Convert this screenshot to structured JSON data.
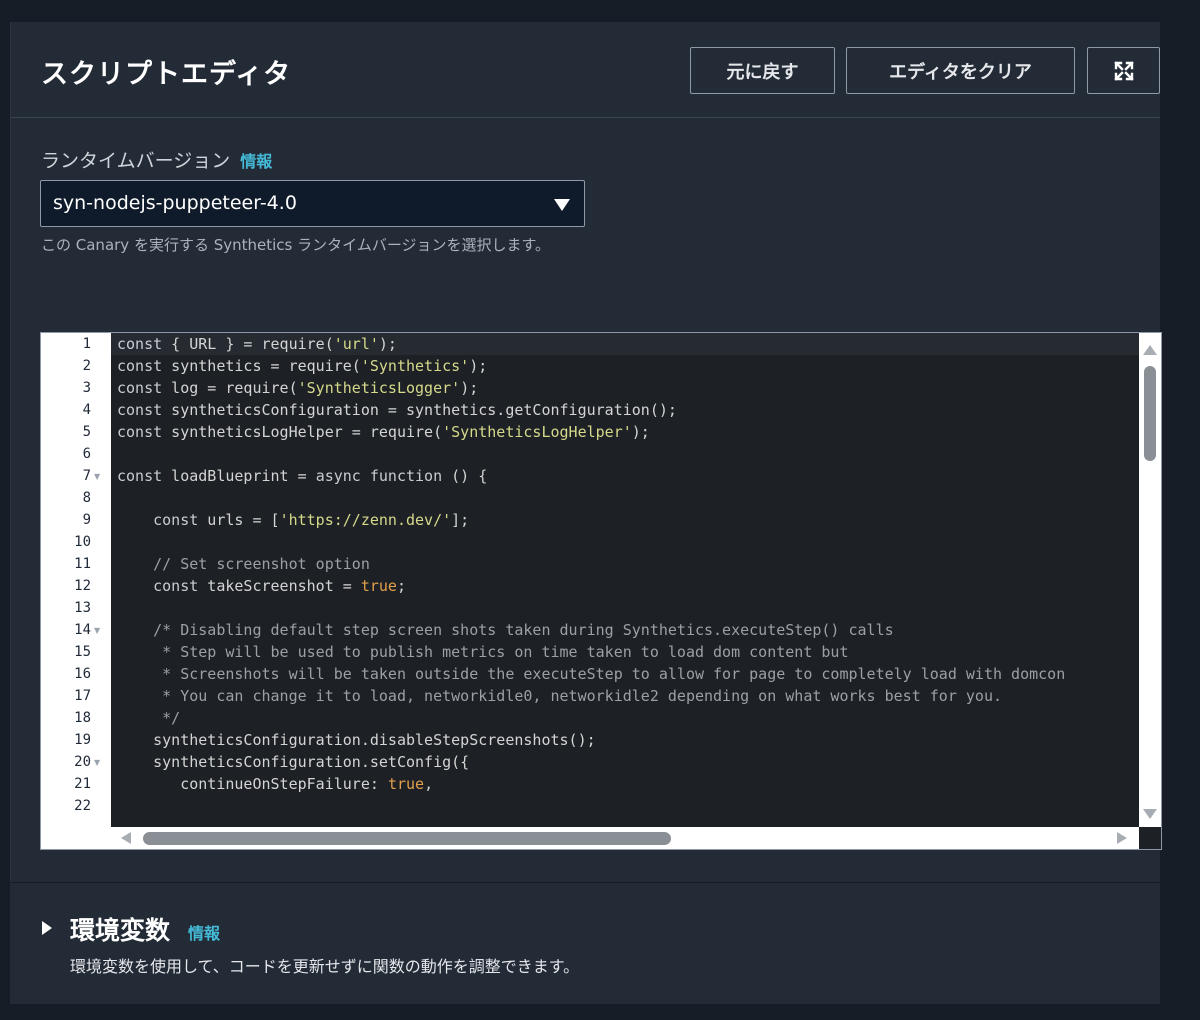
{
  "header": {
    "title": "スクリプトエディタ",
    "undo_label": "元に戻す",
    "clear_label": "エディタをクリア"
  },
  "runtime": {
    "label": "ランタイムバージョン",
    "info": "情報",
    "selected": "syn-nodejs-puppeteer-4.0",
    "hint": "この Canary を実行する Synthetics ランタイムバージョンを選択します。"
  },
  "editor": {
    "line_numbers": [
      "1",
      "2",
      "3",
      "4",
      "5",
      "6",
      "7",
      "8",
      "9",
      "10",
      "11",
      "12",
      "13",
      "14",
      "15",
      "16",
      "17",
      "18",
      "19",
      "20",
      "21",
      "22"
    ],
    "fold_lines": [
      7,
      14,
      20
    ],
    "lines": [
      "const { URL } = require('url');",
      "const synthetics = require('Synthetics');",
      "const log = require('SyntheticsLogger');",
      "const syntheticsConfiguration = synthetics.getConfiguration();",
      "const syntheticsLogHelper = require('SyntheticsLogHelper');",
      "",
      "const loadBlueprint = async function () {",
      "",
      "    const urls = ['https://zenn.dev/'];",
      "",
      "    // Set screenshot option",
      "    const takeScreenshot = true;",
      "",
      "    /* Disabling default step screen shots taken during Synthetics.executeStep() calls",
      "     * Step will be used to publish metrics on time taken to load dom content but",
      "     * Screenshots will be taken outside the executeStep to allow for page to completely load with domcon",
      "     * You can change it to load, networkidle0, networkidle2 depending on what works best for you.",
      "     */",
      "    syntheticsConfiguration.disableStepScreenshots();",
      "    syntheticsConfiguration.setConfig({",
      "       continueOnStepFailure: true,",
      ""
    ]
  },
  "env": {
    "title": "環境変数",
    "info": "情報",
    "description": "環境変数を使用して、コードを更新せずに関数の動作を調整できます。"
  },
  "icons": {
    "expand": "expand-icon",
    "dropdown": "caret-down-icon",
    "section_toggle": "caret-right-icon"
  },
  "colors": {
    "panel_bg": "#232b36",
    "page_bg": "#161d26",
    "link": "#44b9d6",
    "code_bg": "#1d2126",
    "string": "#d6d98a",
    "boolean": "#e2a04a"
  }
}
